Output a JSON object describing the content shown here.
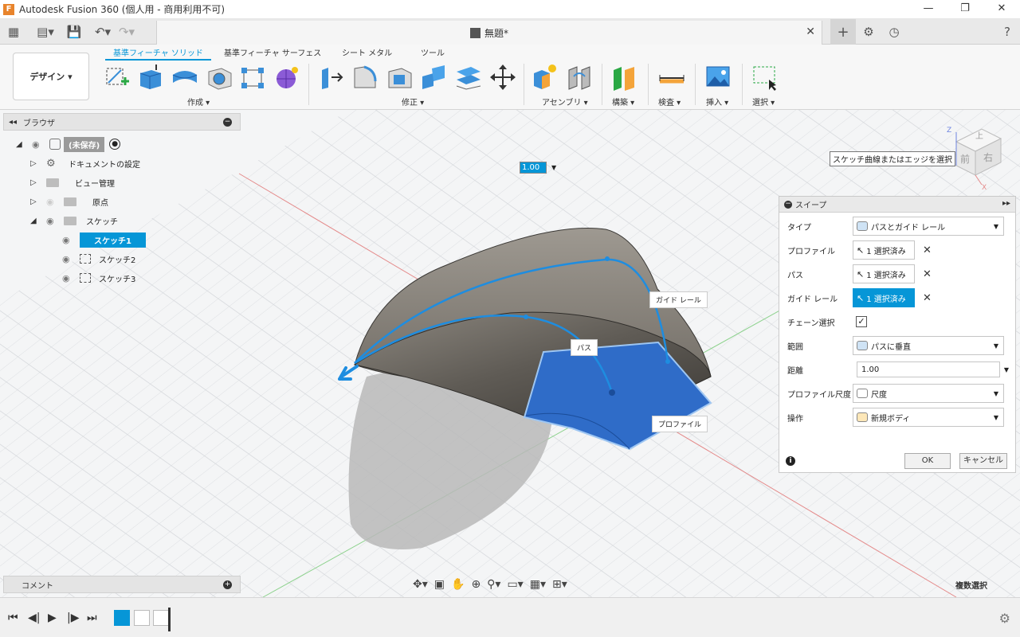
{
  "window": {
    "title": "Autodesk Fusion 360 (個人用 - 商用利用不可)",
    "min": "—",
    "max": "❐",
    "close": "✕"
  },
  "document": {
    "title": "無題*",
    "close": "✕"
  },
  "toolbar": {
    "design_label": "デザイン",
    "tabs": [
      "基準フィーチャ ソリッド",
      "基準フィーチャ サーフェス",
      "シート メタル",
      "ツール"
    ],
    "groups": [
      "作成",
      "修正",
      "アセンブリ",
      "構築",
      "検査",
      "挿入",
      "選択"
    ]
  },
  "browser": {
    "title": "ブラウザ",
    "root": "(未保存)",
    "items": [
      {
        "label": "ドキュメントの設定"
      },
      {
        "label": "ビュー管理"
      },
      {
        "label": "原点"
      },
      {
        "label": "スケッチ"
      },
      {
        "label": "スケッチ1"
      },
      {
        "label": "スケッチ2"
      },
      {
        "label": "スケッチ3"
      }
    ]
  },
  "viewport": {
    "tooltip": "スケッチ曲線またはエッジを選択",
    "distance_input": "1.00",
    "callouts": {
      "guide_rail": "ガイド レール",
      "path": "パス",
      "profile": "プロファイル"
    },
    "multi_select": "複数選択",
    "viewcube": {
      "front": "前",
      "right": "右",
      "top": "上",
      "z": "Z",
      "x": "X"
    }
  },
  "sweep_panel": {
    "title": "スイープ",
    "rows": {
      "type": {
        "label": "タイプ",
        "value": "パスとガイド レール"
      },
      "profile": {
        "label": "プロファイル",
        "value": "1 選択済み"
      },
      "path": {
        "label": "パス",
        "value": "1 選択済み"
      },
      "guide_rail": {
        "label": "ガイド レール",
        "value": "1 選択済み"
      },
      "chain": {
        "label": "チェーン選択",
        "checked": "✓"
      },
      "extent": {
        "label": "範囲",
        "value": "パスに垂直"
      },
      "distance": {
        "label": "距離",
        "value": "1.00"
      },
      "profile_scale": {
        "label": "プロファイル尺度",
        "value": "尺度"
      },
      "operation": {
        "label": "操作",
        "value": "新規ボディ"
      }
    },
    "ok": "OK",
    "cancel": "キャンセル"
  },
  "comments": {
    "title": "コメント"
  },
  "colors": {
    "accent": "#0696d7",
    "surface": "#6f6a62",
    "profile": "#2f6cc8"
  }
}
